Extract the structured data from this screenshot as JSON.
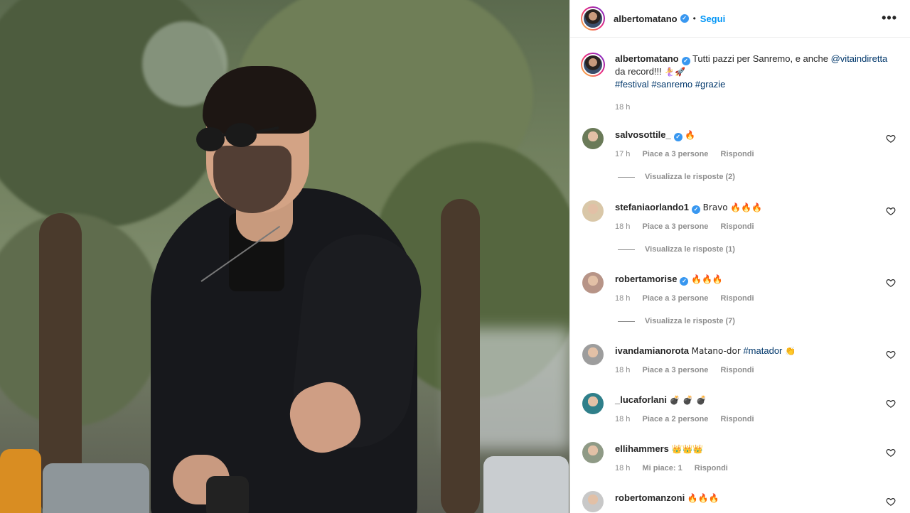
{
  "post": {
    "author": "albertomatano",
    "follow_label": "Segui",
    "more_label": "•••",
    "caption_text": "Tutti pazzi per Sanremo, e anche",
    "caption_mention": "@vitaindiretta",
    "caption_text2": "da record!!!",
    "caption_emojis": "🧜‍♀️🚀",
    "hashtags": [
      "#festival",
      "#sanremo",
      "#grazie"
    ],
    "time": "18 h"
  },
  "comments": [
    {
      "user": "salvosottile_",
      "verified": true,
      "text": "🔥",
      "hashtag": "",
      "time": "17 h",
      "likes": "Piace a 3 persone",
      "reply": "Rispondi",
      "replies": "Visualizza le risposte (2)",
      "avatar_color": "#6a7a58"
    },
    {
      "user": "stefaniaorlando1",
      "verified": true,
      "text": "Bravo 🔥🔥🔥",
      "hashtag": "",
      "time": "18 h",
      "likes": "Piace a 3 persone",
      "reply": "Rispondi",
      "replies": "Visualizza le risposte (1)",
      "avatar_color": "#d9c7a8"
    },
    {
      "user": "robertamorise",
      "verified": true,
      "text": "🔥🔥🔥",
      "hashtag": "",
      "time": "18 h",
      "likes": "Piace a 3 persone",
      "reply": "Rispondi",
      "replies": "Visualizza le risposte (7)",
      "avatar_color": "#b79487"
    },
    {
      "user": "ivandamianorota",
      "verified": false,
      "text": "Matano-dor",
      "hashtag": "#matador",
      "emoji_after": "👏",
      "time": "18 h",
      "likes": "Piace a 3 persone",
      "reply": "Rispondi",
      "replies": "",
      "avatar_color": "#9d9d9d"
    },
    {
      "user": "_lucaforlani",
      "verified": false,
      "text": "💣 💣 💣",
      "hashtag": "",
      "time": "18 h",
      "likes": "Piace a 2 persone",
      "reply": "Rispondi",
      "replies": "",
      "avatar_color": "#2f7f8a"
    },
    {
      "user": "ellihammers",
      "verified": false,
      "text": "👑👑👑",
      "hashtag": "",
      "time": "18 h",
      "likes": "Mi piace: 1",
      "reply": "Rispondi",
      "replies": "",
      "avatar_color": "#8f9a86"
    },
    {
      "user": "robertomanzoni",
      "verified": false,
      "text": "🔥🔥🔥",
      "hashtag": "",
      "time": "",
      "likes": "",
      "reply": "",
      "replies": "",
      "avatar_color": "#c8c8c8"
    }
  ],
  "colors": {
    "accent": "#0095f6",
    "verified": "#3897f0",
    "link": "#00376b",
    "muted": "#8e8e8e"
  }
}
